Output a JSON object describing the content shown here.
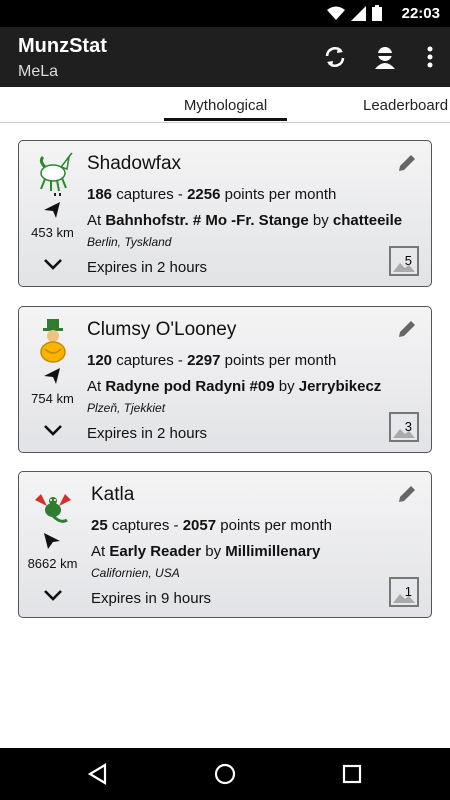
{
  "status_bar": {
    "time": "22:03",
    "icons": [
      "wifi-icon",
      "signal-icon",
      "battery-icon"
    ]
  },
  "app_bar": {
    "title": "MunzStat",
    "subtitle": "MeLa",
    "actions": [
      "refresh-icon",
      "account-icon",
      "more-vert-icon"
    ]
  },
  "tabs": {
    "active": "Mythological",
    "other": "Leaderboard"
  },
  "cards": [
    {
      "name": "Shadowfax",
      "captures": "186",
      "captures_label": " captures - ",
      "points": "2256",
      "points_label": " points per month",
      "at_label": "At ",
      "location": "Bahnhofstr. # Mo -Fr. Stange",
      "by_label": " by ",
      "owner": "chatteeile",
      "place": "Berlin, Tyskland",
      "distance": "453 km",
      "expires": "Expires in 2 hours",
      "badge": "5"
    },
    {
      "name": "Clumsy O'Looney",
      "captures": "120",
      "captures_label": " captures - ",
      "points": "2297",
      "points_label": " points per month",
      "at_label": "At ",
      "location": "Radyne pod Radyni #09",
      "by_label": " by ",
      "owner": "Jerrybikecz",
      "place": "Plzeň, Tjekkiet",
      "distance": "754 km",
      "expires": "Expires in 2 hours",
      "badge": "3"
    },
    {
      "name": "Katla",
      "captures": "25",
      "captures_label": " captures - ",
      "points": "2057",
      "points_label": " points per month",
      "at_label": "At ",
      "location": "Early Reader",
      "by_label": " by ",
      "owner": "Millimillenary",
      "place": "Californien, USA",
      "distance": "8662 km",
      "expires": "Expires in 9 hours",
      "badge": "1"
    }
  ],
  "nav_bar": {
    "buttons": [
      "back-icon",
      "home-icon",
      "recents-icon"
    ]
  }
}
